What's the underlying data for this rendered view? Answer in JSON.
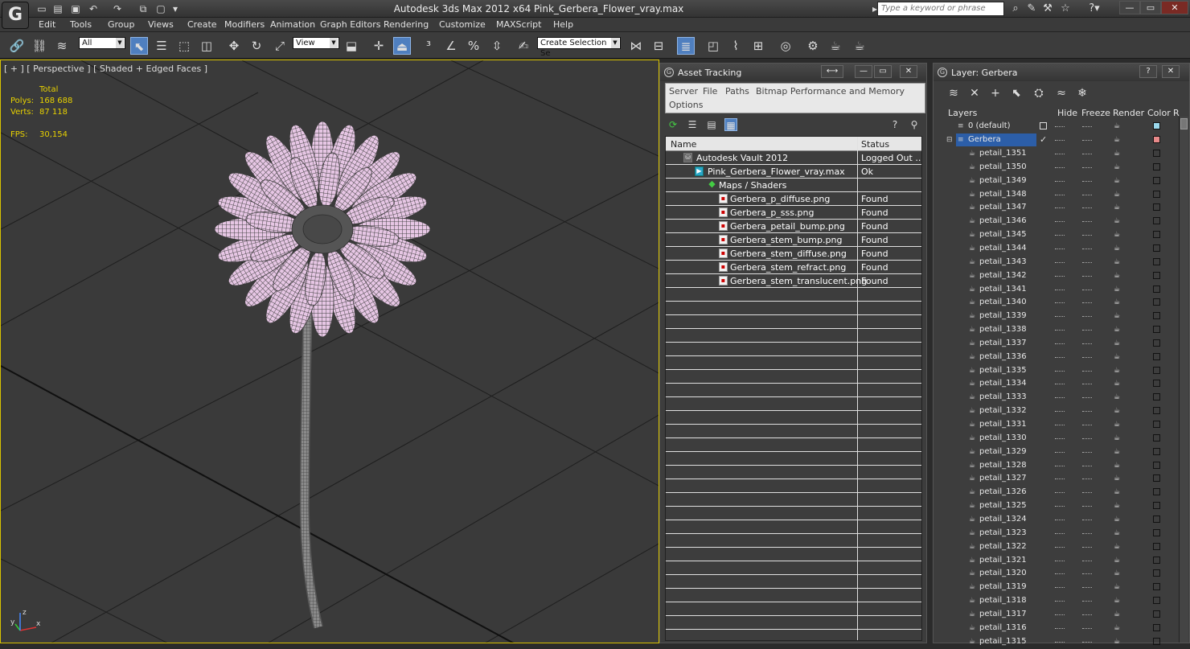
{
  "window": {
    "title": "Autodesk 3ds Max  2012 x64      Pink_Gerbera_Flower_vray.max",
    "search_placeholder": "Type a keyword or phrase"
  },
  "menu": [
    "Edit",
    "Tools",
    "Group",
    "Views",
    "Create",
    "Modifiers",
    "Animation",
    "Graph Editors",
    "Rendering",
    "Customize",
    "MAXScript",
    "Help"
  ],
  "toolbar": {
    "filter_value": "All",
    "refcoord_value": "View",
    "selection_set_placeholder": "Create Selection Se"
  },
  "viewport": {
    "label": "[ + ] [ Perspective ] [ Shaded + Edged Faces ]",
    "total_label": "Total",
    "polys_label": "Polys:",
    "polys_value": "168 688",
    "verts_label": "Verts:",
    "verts_value": "87 118",
    "fps_label": "FPS:",
    "fps_value": "30,154",
    "axis_x": "x",
    "axis_y": "y",
    "axis_z": "z"
  },
  "asset_tracking": {
    "title": "Asset Tracking",
    "menu": [
      "Server",
      "File",
      "Paths",
      "Bitmap Performance and Memory",
      "Options"
    ],
    "col_name": "Name",
    "col_status": "Status",
    "rows": [
      {
        "name": "Autodesk Vault 2012",
        "status": "Logged Out ..."
      },
      {
        "name": "Pink_Gerbera_Flower_vray.max",
        "status": "Ok"
      },
      {
        "name": "Maps / Shaders",
        "status": ""
      },
      {
        "name": "Gerbera_p_diffuse.png",
        "status": "Found"
      },
      {
        "name": "Gerbera_p_sss.png",
        "status": "Found"
      },
      {
        "name": "Gerbera_petail_bump.png",
        "status": "Found"
      },
      {
        "name": "Gerbera_stem_bump.png",
        "status": "Found"
      },
      {
        "name": "Gerbera_stem_diffuse.png",
        "status": "Found"
      },
      {
        "name": "Gerbera_stem_refract.png",
        "status": "Found"
      },
      {
        "name": "Gerbera_stem_translucent.png",
        "status": "Found"
      }
    ]
  },
  "layer_panel": {
    "title": "Layer: Gerbera",
    "col_layers": "Layers",
    "col_hide": "Hide",
    "col_freeze": "Freeze",
    "col_render": "Render",
    "col_color": "Color",
    "col_extra": "R",
    "layers": [
      {
        "name": "0 (default)",
        "color": "#9ad8ec"
      },
      {
        "name": "Gerbera",
        "color": "#e88a8a"
      }
    ],
    "objects": [
      "petail_1351",
      "petail_1350",
      "petail_1349",
      "petail_1348",
      "petail_1347",
      "petail_1346",
      "petail_1345",
      "petail_1344",
      "petail_1343",
      "petail_1342",
      "petail_1341",
      "petail_1340",
      "petail_1339",
      "petail_1338",
      "petail_1337",
      "petail_1336",
      "petail_1335",
      "petail_1334",
      "petail_1333",
      "petail_1332",
      "petail_1331",
      "petail_1330",
      "petail_1329",
      "petail_1328",
      "petail_1327",
      "petail_1326",
      "petail_1325",
      "petail_1324",
      "petail_1323",
      "petail_1322",
      "petail_1321",
      "petail_1320",
      "petail_1319",
      "petail_1318",
      "petail_1317",
      "petail_1316",
      "petail_1315"
    ]
  }
}
